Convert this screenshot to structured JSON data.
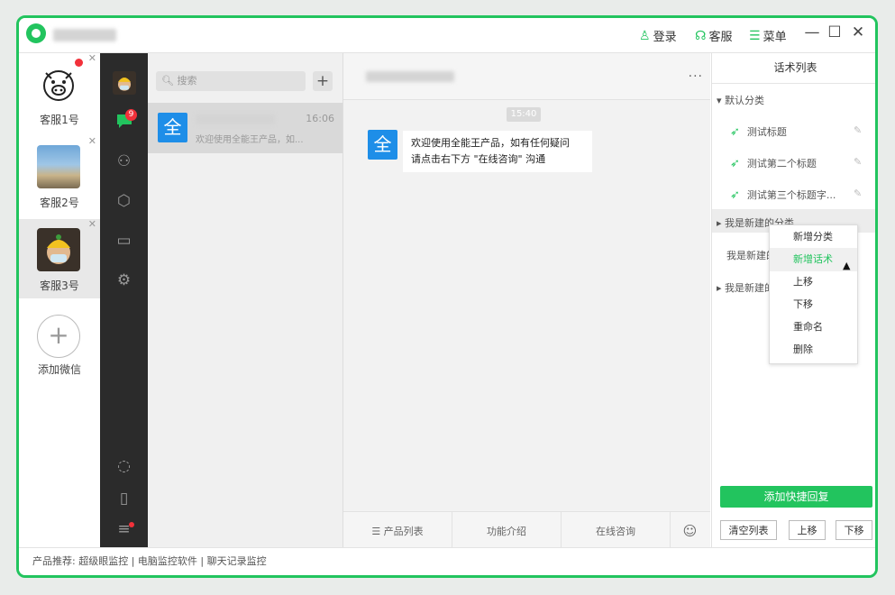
{
  "titlebar": {
    "login": "登录",
    "service": "客服",
    "menu": "菜单",
    "minimize": "—",
    "maximize": "☐",
    "close": "✕"
  },
  "accounts": [
    {
      "name": "客服1号"
    },
    {
      "name": "客服2号"
    },
    {
      "name": "客服3号"
    }
  ],
  "add_account": {
    "label": "添加微信"
  },
  "iconbar": {
    "chat_badge": "9"
  },
  "search": {
    "placeholder": "搜索"
  },
  "conversation": {
    "time": "16:06",
    "avatar": "全",
    "preview": "欢迎使用全能王产品，如..."
  },
  "chat": {
    "menu_dots": "···",
    "time": "15:40",
    "avatar": "全",
    "message_line1": "欢迎使用全能王产品，如有任何疑问",
    "message_line2": "请点击右下方 \"在线咨询\" 沟通",
    "footer": {
      "product_list": "☰ 产品列表",
      "features": "功能介绍",
      "consult": "在线咨询"
    }
  },
  "right": {
    "title": "话术列表",
    "default_category": "默认分类",
    "phrases": [
      "测试标题",
      "测试第二个标题",
      "测试第三个标题字..."
    ],
    "cat2": "我是新建的分类",
    "cat3": "我是新建的分",
    "cat4": "我是新建的分",
    "add_button": "添加快捷回复",
    "clear": "清空列表",
    "up": "上移",
    "down": "下移"
  },
  "context_menu": [
    "新增分类",
    "新增话术",
    "上移",
    "下移",
    "重命名",
    "删除"
  ],
  "status": {
    "text": "产品推荐:  超级眼监控 | 电脑监控软件 | 聊天记录监控"
  },
  "colors": {
    "accent": "#22c45e",
    "blue": "#1e8ee8",
    "dark": "#2b2b2b",
    "badge": "#f2313a"
  }
}
